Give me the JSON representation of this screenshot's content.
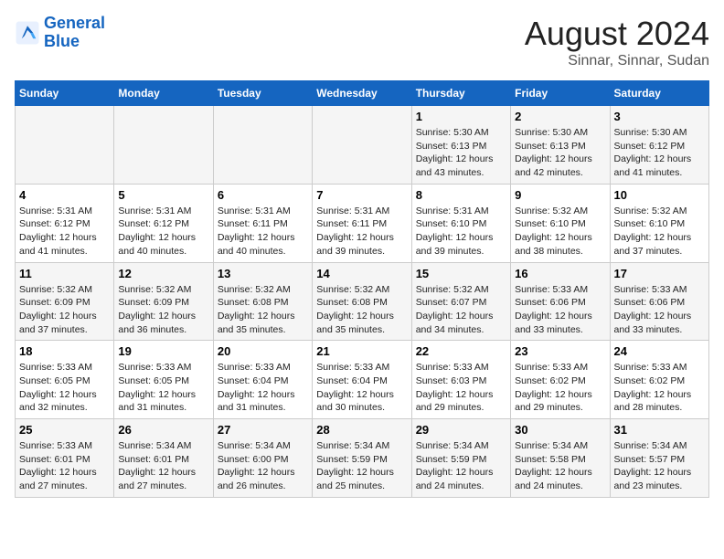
{
  "logo": {
    "text_general": "General",
    "text_blue": "Blue"
  },
  "title": "August 2024",
  "subtitle": "Sinnar, Sinnar, Sudan",
  "header_days": [
    "Sunday",
    "Monday",
    "Tuesday",
    "Wednesday",
    "Thursday",
    "Friday",
    "Saturday"
  ],
  "weeks": [
    [
      {
        "day": "",
        "info": ""
      },
      {
        "day": "",
        "info": ""
      },
      {
        "day": "",
        "info": ""
      },
      {
        "day": "",
        "info": ""
      },
      {
        "day": "1",
        "info": "Sunrise: 5:30 AM\nSunset: 6:13 PM\nDaylight: 12 hours\nand 43 minutes."
      },
      {
        "day": "2",
        "info": "Sunrise: 5:30 AM\nSunset: 6:13 PM\nDaylight: 12 hours\nand 42 minutes."
      },
      {
        "day": "3",
        "info": "Sunrise: 5:30 AM\nSunset: 6:12 PM\nDaylight: 12 hours\nand 41 minutes."
      }
    ],
    [
      {
        "day": "4",
        "info": "Sunrise: 5:31 AM\nSunset: 6:12 PM\nDaylight: 12 hours\nand 41 minutes."
      },
      {
        "day": "5",
        "info": "Sunrise: 5:31 AM\nSunset: 6:12 PM\nDaylight: 12 hours\nand 40 minutes."
      },
      {
        "day": "6",
        "info": "Sunrise: 5:31 AM\nSunset: 6:11 PM\nDaylight: 12 hours\nand 40 minutes."
      },
      {
        "day": "7",
        "info": "Sunrise: 5:31 AM\nSunset: 6:11 PM\nDaylight: 12 hours\nand 39 minutes."
      },
      {
        "day": "8",
        "info": "Sunrise: 5:31 AM\nSunset: 6:10 PM\nDaylight: 12 hours\nand 39 minutes."
      },
      {
        "day": "9",
        "info": "Sunrise: 5:32 AM\nSunset: 6:10 PM\nDaylight: 12 hours\nand 38 minutes."
      },
      {
        "day": "10",
        "info": "Sunrise: 5:32 AM\nSunset: 6:10 PM\nDaylight: 12 hours\nand 37 minutes."
      }
    ],
    [
      {
        "day": "11",
        "info": "Sunrise: 5:32 AM\nSunset: 6:09 PM\nDaylight: 12 hours\nand 37 minutes."
      },
      {
        "day": "12",
        "info": "Sunrise: 5:32 AM\nSunset: 6:09 PM\nDaylight: 12 hours\nand 36 minutes."
      },
      {
        "day": "13",
        "info": "Sunrise: 5:32 AM\nSunset: 6:08 PM\nDaylight: 12 hours\nand 35 minutes."
      },
      {
        "day": "14",
        "info": "Sunrise: 5:32 AM\nSunset: 6:08 PM\nDaylight: 12 hours\nand 35 minutes."
      },
      {
        "day": "15",
        "info": "Sunrise: 5:32 AM\nSunset: 6:07 PM\nDaylight: 12 hours\nand 34 minutes."
      },
      {
        "day": "16",
        "info": "Sunrise: 5:33 AM\nSunset: 6:06 PM\nDaylight: 12 hours\nand 33 minutes."
      },
      {
        "day": "17",
        "info": "Sunrise: 5:33 AM\nSunset: 6:06 PM\nDaylight: 12 hours\nand 33 minutes."
      }
    ],
    [
      {
        "day": "18",
        "info": "Sunrise: 5:33 AM\nSunset: 6:05 PM\nDaylight: 12 hours\nand 32 minutes."
      },
      {
        "day": "19",
        "info": "Sunrise: 5:33 AM\nSunset: 6:05 PM\nDaylight: 12 hours\nand 31 minutes."
      },
      {
        "day": "20",
        "info": "Sunrise: 5:33 AM\nSunset: 6:04 PM\nDaylight: 12 hours\nand 31 minutes."
      },
      {
        "day": "21",
        "info": "Sunrise: 5:33 AM\nSunset: 6:04 PM\nDaylight: 12 hours\nand 30 minutes."
      },
      {
        "day": "22",
        "info": "Sunrise: 5:33 AM\nSunset: 6:03 PM\nDaylight: 12 hours\nand 29 minutes."
      },
      {
        "day": "23",
        "info": "Sunrise: 5:33 AM\nSunset: 6:02 PM\nDaylight: 12 hours\nand 29 minutes."
      },
      {
        "day": "24",
        "info": "Sunrise: 5:33 AM\nSunset: 6:02 PM\nDaylight: 12 hours\nand 28 minutes."
      }
    ],
    [
      {
        "day": "25",
        "info": "Sunrise: 5:33 AM\nSunset: 6:01 PM\nDaylight: 12 hours\nand 27 minutes."
      },
      {
        "day": "26",
        "info": "Sunrise: 5:34 AM\nSunset: 6:01 PM\nDaylight: 12 hours\nand 27 minutes."
      },
      {
        "day": "27",
        "info": "Sunrise: 5:34 AM\nSunset: 6:00 PM\nDaylight: 12 hours\nand 26 minutes."
      },
      {
        "day": "28",
        "info": "Sunrise: 5:34 AM\nSunset: 5:59 PM\nDaylight: 12 hours\nand 25 minutes."
      },
      {
        "day": "29",
        "info": "Sunrise: 5:34 AM\nSunset: 5:59 PM\nDaylight: 12 hours\nand 24 minutes."
      },
      {
        "day": "30",
        "info": "Sunrise: 5:34 AM\nSunset: 5:58 PM\nDaylight: 12 hours\nand 24 minutes."
      },
      {
        "day": "31",
        "info": "Sunrise: 5:34 AM\nSunset: 5:57 PM\nDaylight: 12 hours\nand 23 minutes."
      }
    ]
  ]
}
